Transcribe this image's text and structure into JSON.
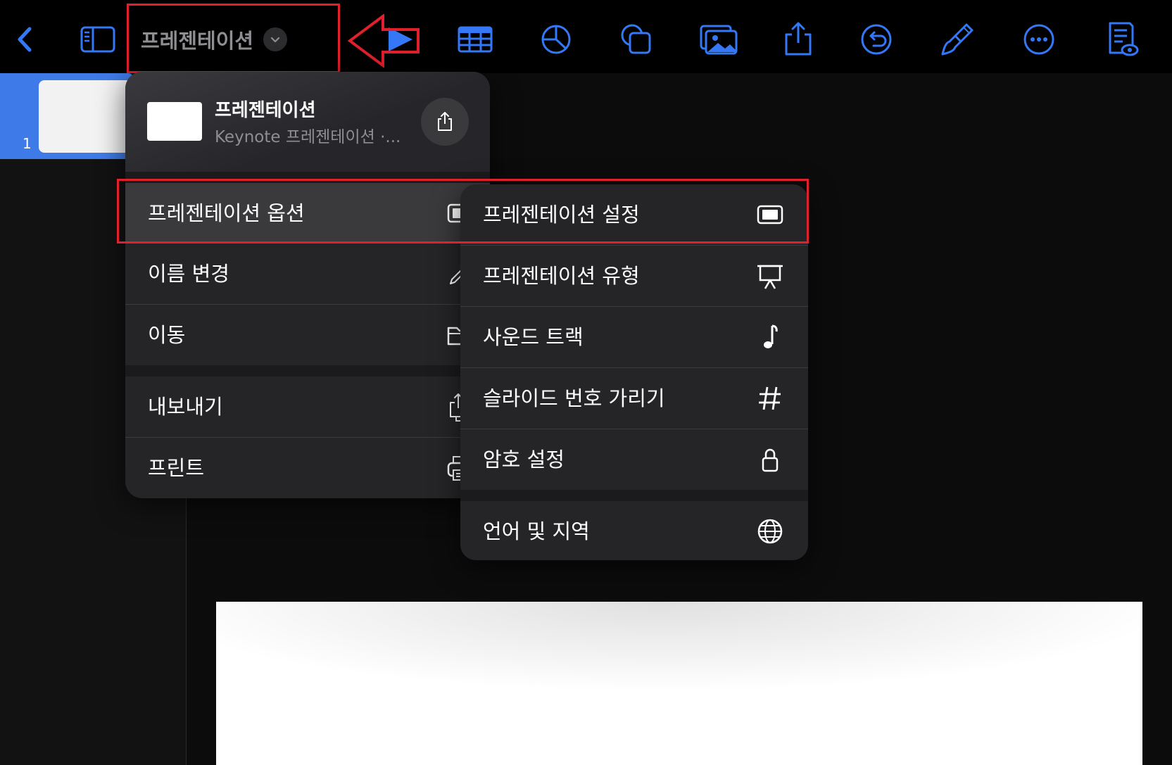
{
  "toolbar": {
    "title": "프레젠테이션",
    "accent": "#3478f6",
    "icons": [
      "back-icon",
      "sidebar-icon",
      "play-icon",
      "table-icon",
      "chart-icon",
      "shapes-icon",
      "media-icon",
      "share-icon",
      "undo-icon",
      "format-brush-icon",
      "more-icon",
      "reader-view-icon"
    ]
  },
  "sidebar": {
    "slide_number": "1"
  },
  "menu": {
    "doc_name": "프레젠테이션",
    "doc_subtitle": "Keynote 프레젠테이션 ·...",
    "items": [
      {
        "label": "프레젠테이션 옵션",
        "icon": "display-icon"
      },
      {
        "label": "이름 변경",
        "icon": "pencil-icon"
      },
      {
        "label": "이동",
        "icon": "folder-icon"
      },
      {
        "label": "내보내기",
        "icon": "export-icon"
      },
      {
        "label": "프린트",
        "icon": "printer-icon"
      }
    ]
  },
  "submenu": {
    "items": [
      {
        "label": "프레젠테이션 설정",
        "icon": "display-icon"
      },
      {
        "label": "프레젠테이션 유형",
        "icon": "easel-icon"
      },
      {
        "label": "사운드 트랙",
        "icon": "music-note-icon"
      },
      {
        "label": "슬라이드 번호 가리기",
        "icon": "hash-icon"
      },
      {
        "label": "암호 설정",
        "icon": "lock-icon"
      },
      {
        "label": "언어 및 지역",
        "icon": "globe-icon"
      }
    ]
  },
  "annotation_color": "#e0202a"
}
